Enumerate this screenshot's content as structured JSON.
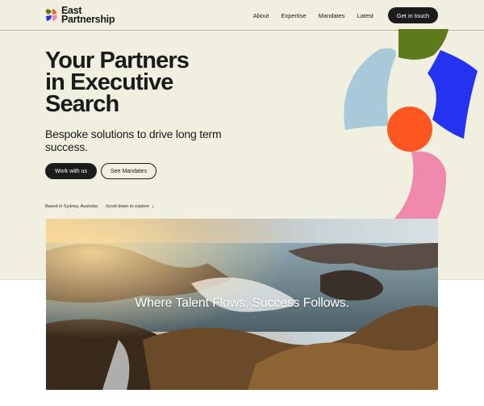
{
  "brand": {
    "name_line1": "East",
    "name_line2": "Partnership",
    "logo_colors": [
      "#2a2ee6",
      "#5a7a1a",
      "#ff5a24",
      "#ef8aa8"
    ]
  },
  "nav": {
    "items": [
      {
        "label": "About"
      },
      {
        "label": "Expertise"
      },
      {
        "label": "Mandates"
      },
      {
        "label": "Latest"
      }
    ],
    "cta_label": "Get in touch"
  },
  "hero": {
    "title_line1": "Your Partners",
    "title_line2": "in Executive",
    "title_line3": "Search",
    "subtitle": "Bespoke solutions to drive long term success.",
    "primary_button": "Work with us",
    "secondary_button": "See Mandates",
    "location": "Based in Sydney, Australia",
    "scroll_hint": "Scroll down to explore",
    "scroll_icon": "arrow-down-icon"
  },
  "shapes": {
    "colors": {
      "light_blue": "#a8c9d8",
      "olive": "#5d7a1c",
      "blue": "#2533f0",
      "orange": "#ff5722",
      "pink": "#ef8aae"
    }
  },
  "feature": {
    "caption": "Where Talent Flows, Success Follows."
  },
  "colors": {
    "hero_background": "#f1efdf",
    "button_dark": "#1c1c1c"
  }
}
